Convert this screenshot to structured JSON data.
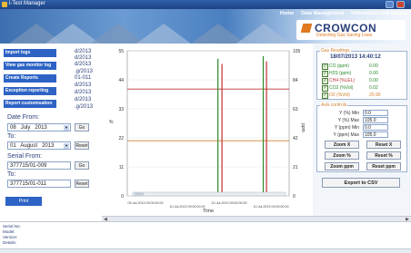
{
  "window": {
    "title": "i-Test Manager"
  },
  "top_menu": [
    "Home",
    "Data Management",
    "Information and Setting"
  ],
  "logo": {
    "name": "CROWCON",
    "tagline": "Detecting Gas Saving Lives"
  },
  "nav": {
    "items": [
      "Import logs",
      "View gas monitor log files",
      "Create Reports",
      "Exception reporting",
      "Report customisation"
    ],
    "session_labels": [
      "d/2013",
      "d/2013",
      "d/2013",
      ".g/2013",
      "01-011",
      "d/2013",
      "d/2013",
      "d/2013",
      ".g/2013"
    ]
  },
  "date_filter": {
    "from_label": "Date From:",
    "from_day": "08",
    "from_month": "July",
    "from_year": "2013",
    "go_label": "Go",
    "to_label": "To:",
    "to_day": "01",
    "to_month": "August",
    "to_year": "2013",
    "reset_label": "Reset"
  },
  "serial_filter": {
    "from_label": "Serial From:",
    "from_value": "377715/01-009",
    "go_label": "Go",
    "to_label": "To:",
    "to_value": "377715/01-011",
    "reset_label": "Reset"
  },
  "print_label": "Print",
  "gas_readings": {
    "title": "Gas Readings",
    "datetime": "18/07/2013 14:40:12",
    "gases": [
      {
        "name": "CO (ppm)",
        "value": "0.00",
        "color": "#2a8a2a"
      },
      {
        "name": "H2S (ppm)",
        "value": "0.00",
        "color": "#2a8a2a"
      },
      {
        "name": "CH4 (%LEL)",
        "value": "0.00",
        "color": "#c03030"
      },
      {
        "name": "CO2 (%Vol)",
        "value": "0.02",
        "color": "#2a8a2a"
      },
      {
        "name": "O2 (%Vol)",
        "value": "20.90",
        "color": "#d08030"
      }
    ]
  },
  "axis_controls": {
    "title": "Axis controls",
    "rows": [
      {
        "label": "Y (%) Min",
        "value": "0.0"
      },
      {
        "label": "Y (%) Max",
        "value": "105.0"
      },
      {
        "label": "Y (ppm) Min",
        "value": "0.0"
      },
      {
        "label": "Y (ppm) Max",
        "value": "105.0"
      }
    ],
    "buttons": [
      "Zoom X",
      "Reset X",
      "Zoom %",
      "Reset %",
      "Zoom ppm",
      "Reset ppm"
    ]
  },
  "export_label": "Export to CSV",
  "bottom_info": [
    "Serial No:",
    "Model:",
    "Version:",
    "Details:"
  ],
  "chart_data": {
    "type": "line",
    "xlabel": "Time",
    "ylabel_left": "%",
    "ylabel_right": "ppm",
    "left_ticks": [
      "0",
      "11",
      "22",
      "33",
      "44",
      "55"
    ],
    "right_ticks": [
      "0",
      "21",
      "42",
      "63",
      "84",
      "105"
    ],
    "x_ticks": [
      "09-Jul-2013 09:00:00.00",
      "10-Jul-2013 09:00:00.00",
      "10-Jul-2013 09:00:00.00",
      "10-Jul-2013 09:00:00.00"
    ],
    "ylim": [
      0,
      55
    ],
    "series": [
      {
        "values": [
          20.9,
          20.9,
          20.9,
          20.9,
          20.9,
          20.9,
          20.9
        ],
        "color": "#d08030"
      },
      {
        "values": [
          40.5,
          40.5,
          40.5,
          40.5,
          40.5,
          40.5,
          40.5
        ],
        "color": "#c03030"
      }
    ],
    "spikes": [
      {
        "series_color": "#2a8a2a",
        "x_frac": 0.56,
        "peak": 52
      },
      {
        "series_color": "#c03030",
        "x_frac": 0.585,
        "peak": 50
      },
      {
        "series_color": "#2a8a2a",
        "x_frac": 0.84,
        "peak": 53
      },
      {
        "series_color": "#c03030",
        "x_frac": 0.86,
        "peak": 51
      }
    ]
  }
}
